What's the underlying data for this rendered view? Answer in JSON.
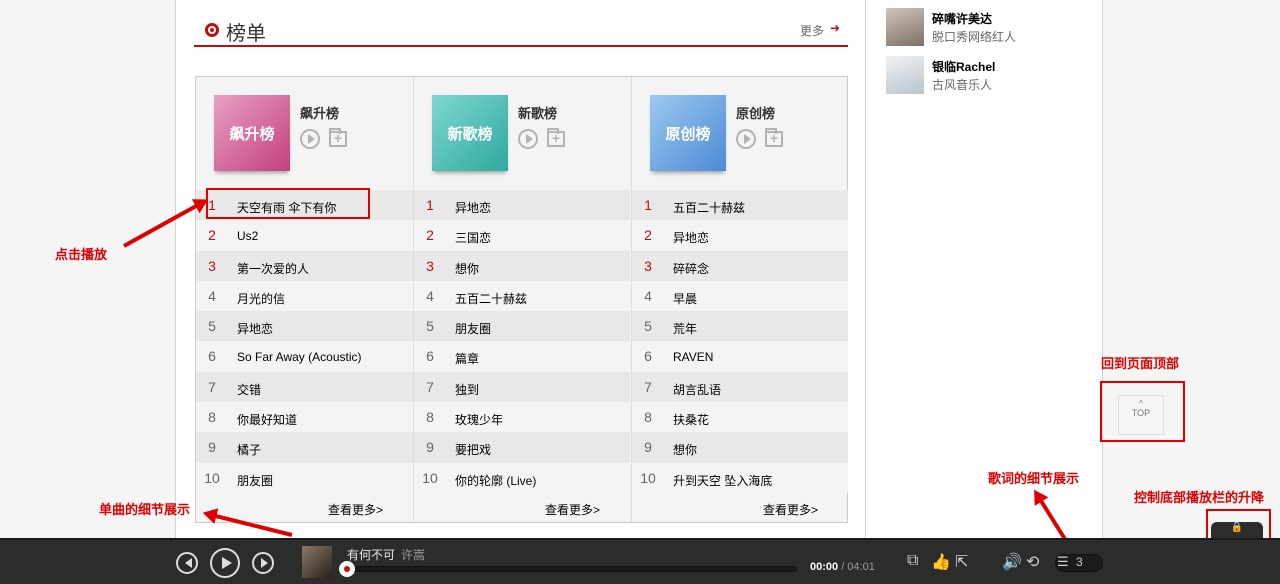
{
  "section": {
    "title": "榜单",
    "more": "更多",
    "more_arrow": "➜"
  },
  "boards": [
    {
      "cover_label": "飙升榜",
      "name": "飙升榜",
      "color": "pink",
      "tracks": [
        "天空有雨 伞下有你",
        "Us2",
        "第一次爱的人",
        "月光的信",
        "异地恋",
        "So Far Away (Acoustic)",
        "交错",
        "你最好知道",
        "橘子",
        "朋友圈"
      ],
      "more": "查看更多>"
    },
    {
      "cover_label": "新歌榜",
      "name": "新歌榜",
      "color": "teal",
      "tracks": [
        "异地恋",
        "三国恋",
        "想你",
        "五百二十赫兹",
        "朋友圈",
        "篇章",
        "独到",
        "玫瑰少年",
        "要把戏",
        "你的轮廓 (Live)"
      ],
      "more": "查看更多>"
    },
    {
      "cover_label": "原创榜",
      "name": "原创榜",
      "color": "blue",
      "tracks": [
        "五百二十赫兹",
        "异地恋",
        "碎碎念",
        "早晨",
        "荒年",
        "RAVEN",
        "胡言乱语",
        "扶桑花",
        "想你",
        "升到天空 坠入海底"
      ],
      "more": "查看更多>"
    }
  ],
  "ranks": [
    "1",
    "2",
    "3",
    "4",
    "5",
    "6",
    "7",
    "8",
    "9",
    "10"
  ],
  "users": [
    {
      "name": "碎嘴许美达",
      "desc": "脱口秀网络红人"
    },
    {
      "name": "银临Rachel",
      "desc": "古风音乐人"
    }
  ],
  "top_button": {
    "label": "TOP",
    "caret": "^"
  },
  "annotations": {
    "click_play": "点击播放",
    "back_top": "回到页面顶部",
    "lyrics_detail": "歌词的细节展示",
    "song_detail": "单曲的细节展示",
    "toggle_bar": "控制底部播放栏的升降"
  },
  "player": {
    "song": "有何不可",
    "artist": "许嵩",
    "current": "00:00",
    "duration": " / 04:01",
    "progress": 0,
    "playlist_count": "3"
  },
  "colors": {
    "accent": "#c10d0c",
    "annotation": "#e00000",
    "player_bg": "#2c2c2c"
  }
}
